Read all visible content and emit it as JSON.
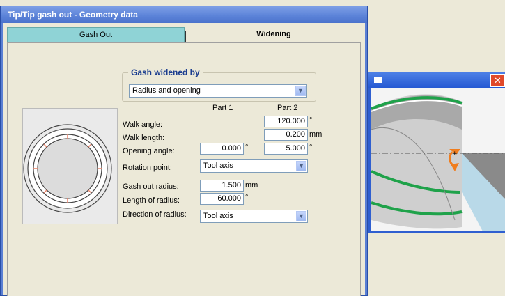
{
  "dialog": {
    "title": "Tip/Tip gash out - Geometry data",
    "tabs": [
      {
        "label": "Gash Out",
        "active": false
      },
      {
        "label": "Widening",
        "active": true
      }
    ]
  },
  "group": {
    "label": "Gash widened by",
    "selected": "Radius and opening"
  },
  "columns": {
    "part1": "Part 1",
    "part2": "Part 2"
  },
  "fields": {
    "walk_angle": {
      "label": "Walk angle:",
      "part2": "120.000",
      "unit2": "°"
    },
    "walk_length": {
      "label": "Walk length:",
      "part2": "0.200",
      "unit2": "mm"
    },
    "opening_angle": {
      "label": "Opening angle:",
      "part1": "0.000",
      "unit1": "°",
      "part2": "5.000",
      "unit2": "°"
    },
    "rotation_point": {
      "label": "Rotation point:",
      "selected": "Tool axis"
    },
    "gash_out_radius": {
      "label": "Gash out radius:",
      "part1": "1.500",
      "unit1": "mm"
    },
    "length_of_radius": {
      "label": "Length of radius:",
      "part1": "60.000",
      "unit1": "°"
    },
    "direction_of_radius": {
      "label": "Direction of radius:",
      "selected": "Tool axis"
    }
  },
  "preview_window": {
    "close_glyph": "✕"
  },
  "colors": {
    "tab_inactive": "#8fd3d6",
    "title_bar": "#5d84d9",
    "group_label": "#1b3d8f",
    "edge_green": "#1fa24a",
    "arrow_orange": "#f07d1e"
  }
}
